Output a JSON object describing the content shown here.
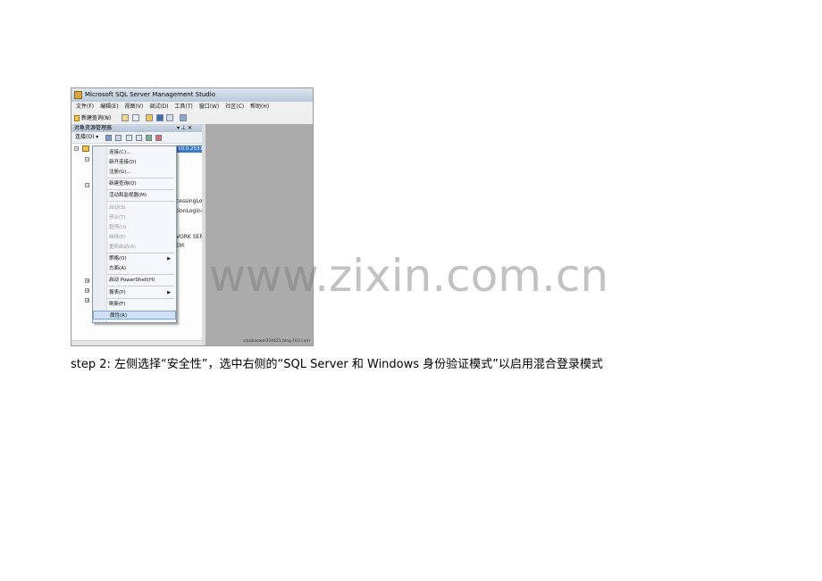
{
  "window": {
    "title": "Microsoft SQL Server Management Studio"
  },
  "menubar": [
    "文件(F)",
    "编辑(E)",
    "视图(V)",
    "调试(D)",
    "工具(T)",
    "窗口(W)",
    "社区(C)",
    "帮助(H)"
  ],
  "toolbar": {
    "new_query_label": "新建查询(N)"
  },
  "object_explorer": {
    "title": "对象资源管理器",
    "pin_controls": "▾ ⊥ ✕",
    "connect_label": "连接(O) ▾",
    "server_version": "10.0.2531",
    "tree_fragments": [
      "cessingLog",
      "tionLogin#",
      "VORK SERV",
      "EM"
    ]
  },
  "context_menu": {
    "items": [
      {
        "label": "连接(C)...",
        "disabled": false
      },
      {
        "label": "新开连接(D)",
        "disabled": false
      },
      {
        "label": "注册(G)...",
        "disabled": false
      },
      {
        "label": "新建查询(Q)",
        "disabled": false
      },
      {
        "label": "活动和监视器(M)",
        "disabled": false
      },
      {
        "label": "启动(S)",
        "disabled": true
      },
      {
        "label": "停止(T)",
        "disabled": true
      },
      {
        "label": "暂停(U)",
        "disabled": true
      },
      {
        "label": "继续(E)",
        "disabled": true
      },
      {
        "label": "重新启动(A)",
        "disabled": true
      },
      {
        "label": "策略(O)",
        "disabled": false,
        "submenu": true
      },
      {
        "label": "方面(A)",
        "disabled": false
      },
      {
        "label": "启动 PowerShell(H)",
        "disabled": false
      },
      {
        "label": "报表(P)",
        "disabled": false,
        "submenu": true
      },
      {
        "label": "刷新(F)",
        "disabled": false
      },
      {
        "label": "属性(R)",
        "disabled": false,
        "highlighted": true
      }
    ]
  },
  "screenshot_watermark": "xiaobaowei334421.blog.163.com",
  "page_watermark": "www.zixin.com.cn",
  "caption": "step 2:  左侧选择“安全性”，选中右侧的“SQL Server  和  Windows  身份验证模式”以启用混合登录模式"
}
